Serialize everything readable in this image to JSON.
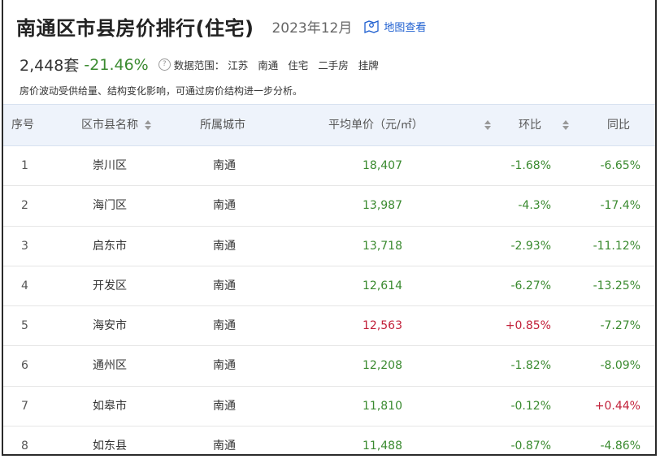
{
  "header": {
    "title": "南通区市县房价排行(住宅)",
    "date": "2023年12月",
    "map_link": "地图查看",
    "map_icon": "map-pin-icon"
  },
  "summary": {
    "count": "2,448套",
    "change": "-21.46%",
    "range_label": "数据范围：",
    "range_tags": [
      "江苏",
      "南通",
      "住宅",
      "二手房",
      "挂牌"
    ]
  },
  "note": "房价波动受供给量、结构变化影响，可通过房价结构进一步分析。",
  "colors": {
    "up": "#c2213a",
    "down": "#3a8a2f",
    "link": "#1e5fd0",
    "header_bg": "#eef3fb"
  },
  "table": {
    "columns": [
      "序号",
      "区市县名称",
      "所属城市",
      "平均单价（元/㎡）",
      "环比",
      "同比"
    ],
    "rows": [
      {
        "idx": "1",
        "name": "崇川区",
        "city": "南通",
        "price": "18,407",
        "price_trend": "down",
        "mom": "-1.68%",
        "mom_trend": "down",
        "yoy": "-6.65%",
        "yoy_trend": "down"
      },
      {
        "idx": "2",
        "name": "海门区",
        "city": "南通",
        "price": "13,987",
        "price_trend": "down",
        "mom": "-4.3%",
        "mom_trend": "down",
        "yoy": "-17.4%",
        "yoy_trend": "down"
      },
      {
        "idx": "3",
        "name": "启东市",
        "city": "南通",
        "price": "13,718",
        "price_trend": "down",
        "mom": "-2.93%",
        "mom_trend": "down",
        "yoy": "-11.12%",
        "yoy_trend": "down"
      },
      {
        "idx": "4",
        "name": "开发区",
        "city": "南通",
        "price": "12,614",
        "price_trend": "down",
        "mom": "-6.27%",
        "mom_trend": "down",
        "yoy": "-13.25%",
        "yoy_trend": "down"
      },
      {
        "idx": "5",
        "name": "海安市",
        "city": "南通",
        "price": "12,563",
        "price_trend": "up",
        "mom": "+0.85%",
        "mom_trend": "up",
        "yoy": "-7.27%",
        "yoy_trend": "down"
      },
      {
        "idx": "6",
        "name": "通州区",
        "city": "南通",
        "price": "12,208",
        "price_trend": "down",
        "mom": "-1.82%",
        "mom_trend": "down",
        "yoy": "-8.09%",
        "yoy_trend": "down"
      },
      {
        "idx": "7",
        "name": "如皋市",
        "city": "南通",
        "price": "11,810",
        "price_trend": "down",
        "mom": "-0.12%",
        "mom_trend": "down",
        "yoy": "+0.44%",
        "yoy_trend": "up"
      },
      {
        "idx": "8",
        "name": "如东县",
        "city": "南通",
        "price": "11,488",
        "price_trend": "down",
        "mom": "-0.87%",
        "mom_trend": "down",
        "yoy": "-4.86%",
        "yoy_trend": "down"
      }
    ]
  }
}
